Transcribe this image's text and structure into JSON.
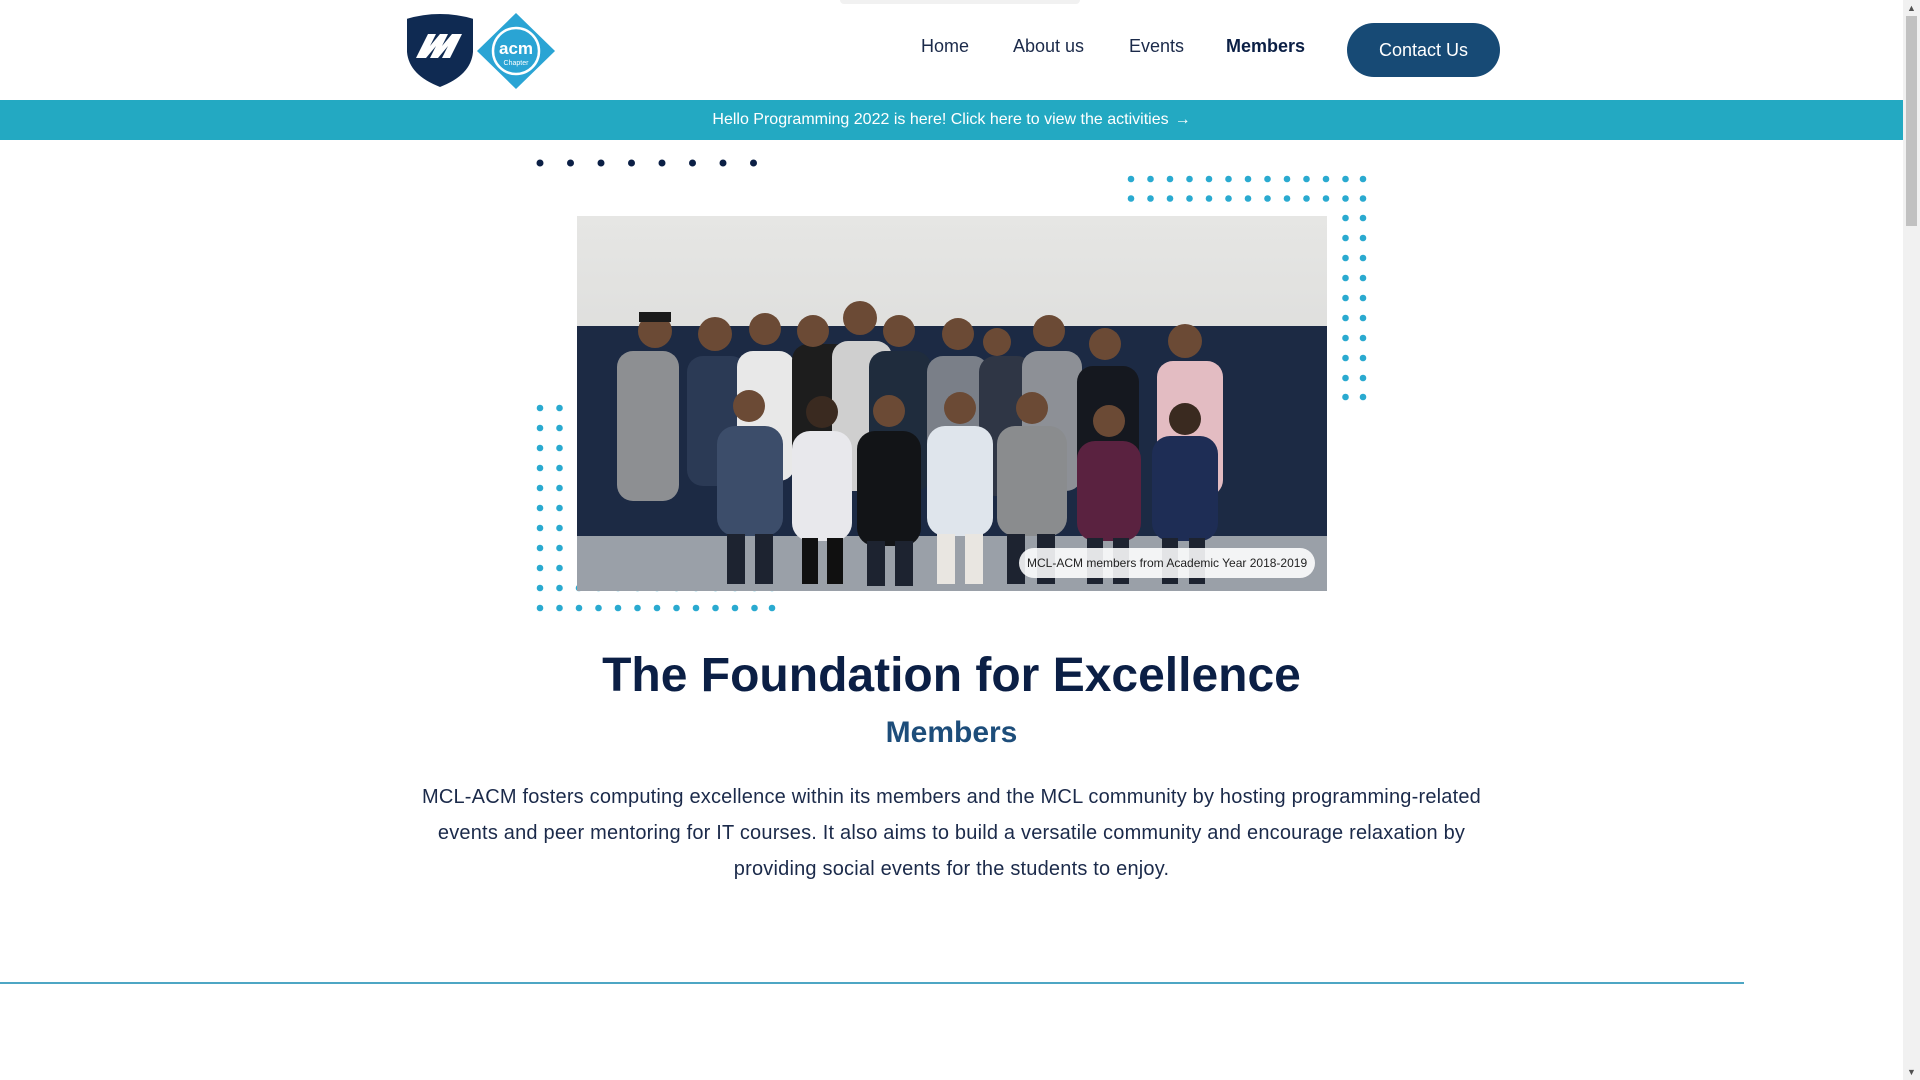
{
  "nav": {
    "home": "Home",
    "about": "About us",
    "events": "Events",
    "members": "Members",
    "contact": "Contact Us"
  },
  "logo": {
    "shield_icon": "mcl-shield-logo",
    "acm_text": "acm",
    "acm_subtext": "Chapter"
  },
  "banner": {
    "text": "Hello Programming 2022 is here! Click here to view the activities",
    "arrow": "→"
  },
  "hero": {
    "caption": "MCL-ACM members from Academic Year 2018-2019"
  },
  "content": {
    "title": "The Foundation for Excellence",
    "subtitle": "Members",
    "description": "MCL-ACM fosters computing excellence within its members and the MCL community by hosting programming-related events and peer mentoring for IT courses. It also aims to build a versatile community and encourage relaxation by providing social events for the students to enjoy."
  },
  "colors": {
    "navy": "#0b1f45",
    "accent_teal": "#23a9c2",
    "button_blue": "#174a75",
    "dot_teal": "#2aaad0"
  },
  "scrollbar": {
    "up": "▲",
    "down": "▼"
  }
}
